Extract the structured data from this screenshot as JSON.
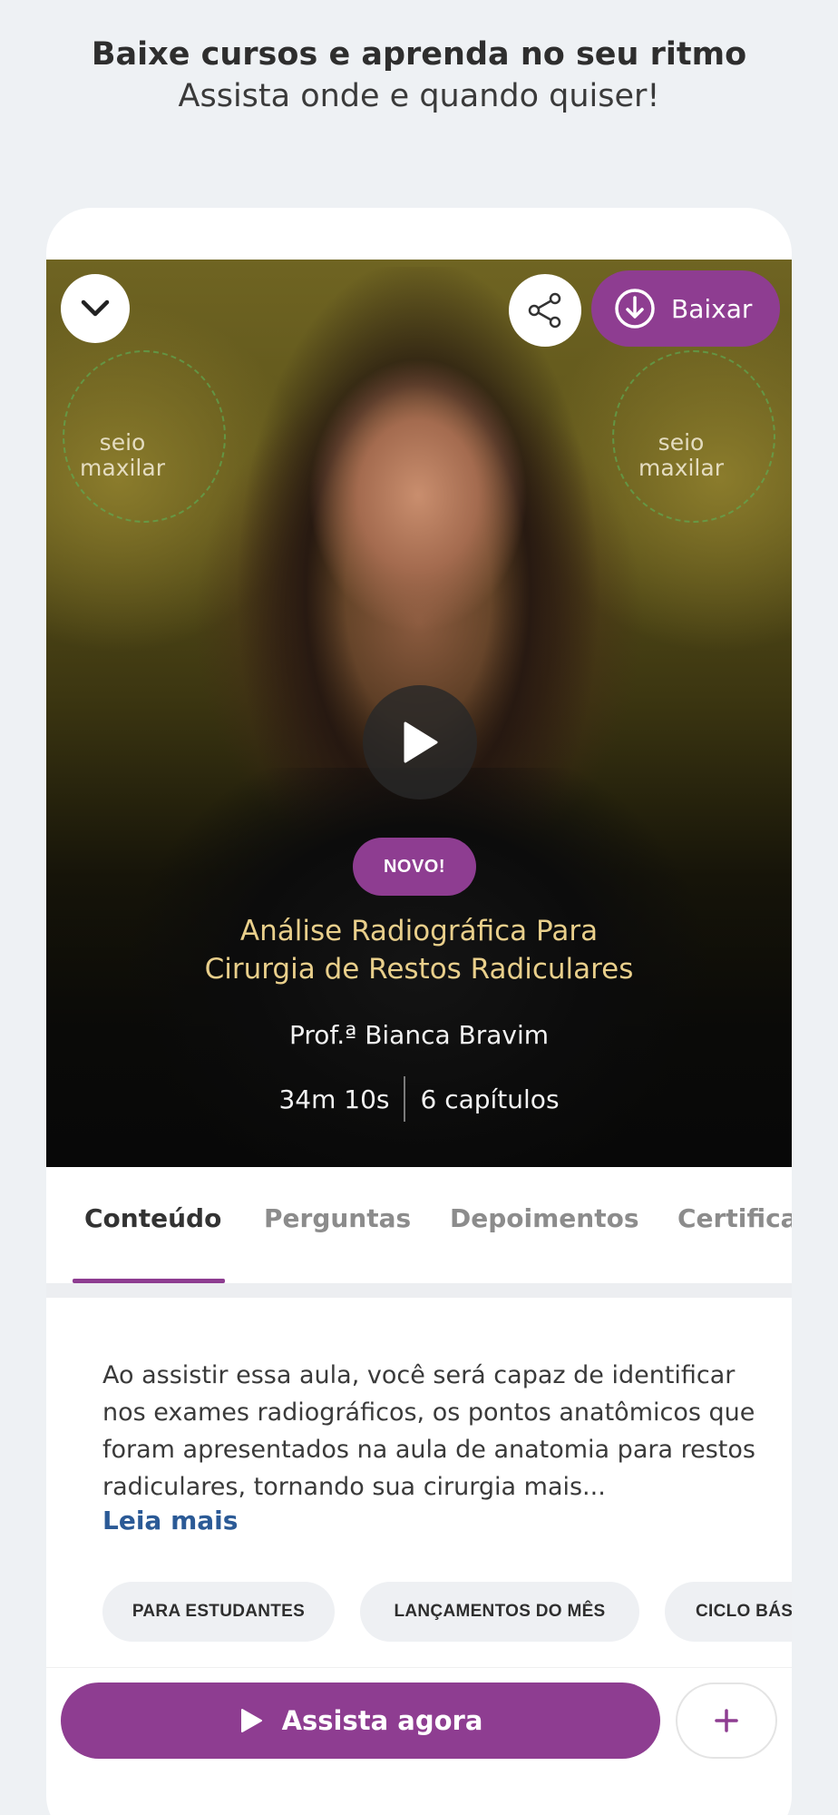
{
  "promo": {
    "title": "Baixe cursos e aprenda no seu ritmo",
    "subtitle": "Assista onde e quando quiser!"
  },
  "hero": {
    "collapse_icon": "chevron-down-icon",
    "share_icon": "share-icon",
    "download_label": "Baixar",
    "download_icon": "download-circle-icon",
    "overlay_left": "seio\nmaxilar",
    "overlay_right": "seio\nmaxilar",
    "play_icon": "play-icon",
    "badge": "NOVO!",
    "title_line1": "Análise Radiográfica Para",
    "title_line2": "Cirurgia de Restos Radiculares",
    "professor": "Prof.ª Bianca Bravim",
    "duration": "34m 10s",
    "chapters": "6 capítulos"
  },
  "tabs": [
    {
      "label": "Conteúdo",
      "active": true
    },
    {
      "label": "Perguntas",
      "active": false
    },
    {
      "label": "Depoimentos",
      "active": false
    },
    {
      "label": "Certificado",
      "active": false
    }
  ],
  "description": {
    "text": "Ao assistir essa aula, você será capaz de identificar nos exames radiográficos, os pontos anatômicos que foram apresentados na aula de anatomia para restos radiculares, tornando sua cirurgia mais...",
    "read_more": "Leia mais"
  },
  "chips": [
    "PARA ESTUDANTES",
    "LANÇAMENTOS DO MÊS",
    "CICLO BÁSICO"
  ],
  "actions": {
    "watch_label": "Assista agora",
    "add_label": "+"
  },
  "colors": {
    "accent": "#8e3d91",
    "link": "#2b5a96",
    "title_gold": "#e9cf8b"
  }
}
